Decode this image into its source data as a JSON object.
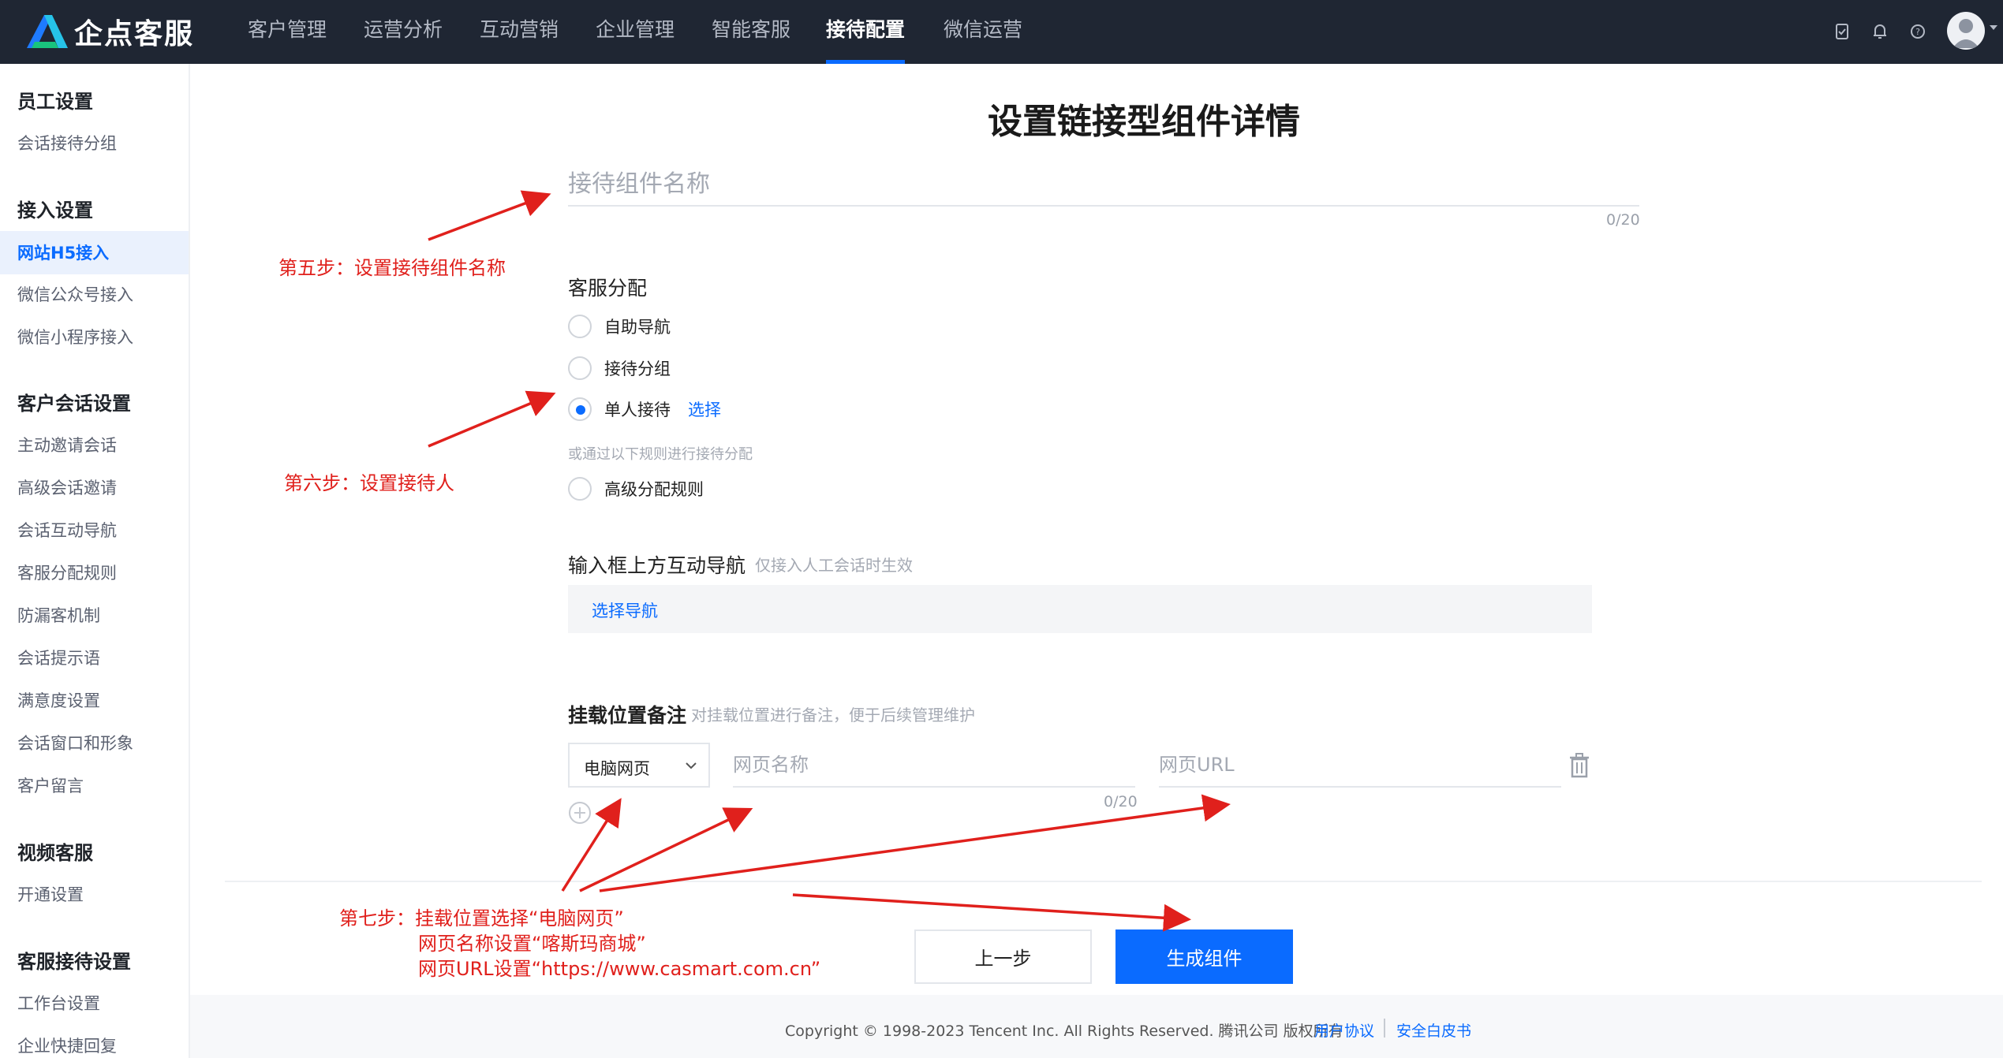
{
  "brand": {
    "name": "企点客服"
  },
  "topnav": {
    "items": [
      "客户管理",
      "运营分析",
      "互动营销",
      "企业管理",
      "智能客服",
      "接待配置",
      "微信运营"
    ],
    "active": "接待配置",
    "icons": [
      "task-icon",
      "bell-icon",
      "help-icon",
      "avatar"
    ]
  },
  "sidebar": {
    "groups": [
      {
        "title": "员工设置",
        "items": [
          "会话接待分组"
        ]
      },
      {
        "title": "接入设置",
        "items": [
          "网站H5接入",
          "微信公众号接入",
          "微信小程序接入"
        ]
      },
      {
        "title": "客户会话设置",
        "items": [
          "主动邀请会话",
          "高级会话邀请",
          "会话互动导航",
          "客服分配规则",
          "防漏客机制",
          "会话提示语",
          "满意度设置",
          "会话窗口和形象",
          "客户留言"
        ]
      },
      {
        "title": "视频客服",
        "items": [
          "开通设置"
        ]
      },
      {
        "title": "客服接待设置",
        "items": [
          "工作台设置",
          "企业快捷回复"
        ]
      }
    ],
    "active_item": "网站H5接入"
  },
  "form": {
    "title": "设置链接型组件详情",
    "name_placeholder": "接待组件名称",
    "name_counter": "0/20",
    "assign": {
      "label": "客服分配",
      "options": [
        "自助导航",
        "接待分组",
        "单人接待"
      ],
      "selected": "单人接待",
      "select_link": "选择",
      "alt_hint": "或通过以下规则进行接待分配",
      "advanced_option": "高级分配规则"
    },
    "interactive_nav": {
      "label": "输入框上方互动导航",
      "hint": "仅接入人工会话时生效",
      "select_link": "选择导航"
    },
    "mount": {
      "label": "挂载位置备注",
      "hint": "对挂载位置进行备注，便于后续管理维护",
      "type_value": "电脑网页",
      "page_name_placeholder": "网页名称",
      "page_name_counter": "0/20",
      "page_url_placeholder": "网页URL"
    },
    "buttons": {
      "prev": "上一步",
      "generate": "生成组件"
    }
  },
  "footer": {
    "copyright": "Copyright © 1998-2023 Tencent Inc. All Rights Reserved. 腾讯公司 版权所有",
    "links": [
      "用户协议",
      "安全白皮书"
    ]
  },
  "annotations": {
    "step5": "第五步：设置接待组件名称",
    "step6": "第六步：设置接待人",
    "step7_line1": "第七步：挂载位置选择“电脑网页”",
    "step7_line2": "网页名称设置“喀斯玛商城”",
    "step7_line3": "网页URL设置“https://www.casmart.com.cn”",
    "color": "#e0201c"
  },
  "colors": {
    "nav_bg": "#1f2633",
    "accent": "#0a6bff"
  }
}
